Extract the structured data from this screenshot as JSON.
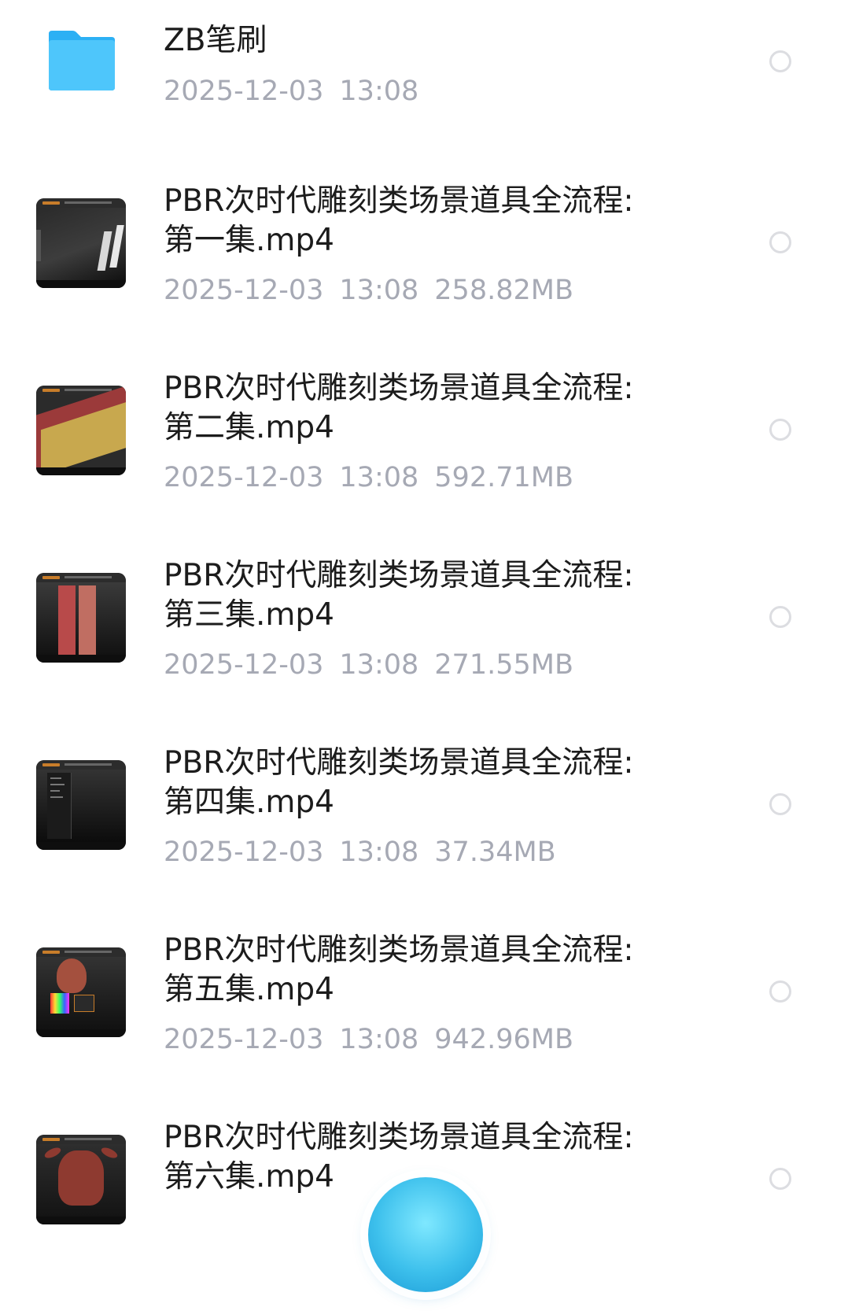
{
  "folder": {
    "name": "ZB笔刷",
    "date": "2025-12-03",
    "time": "13:08",
    "icon": "folder-icon",
    "color": "#2cb6f6"
  },
  "files": [
    {
      "name": "PBR次时代雕刻类场景道具全流程:\n第一集.mp4",
      "date": "2025-12-03",
      "time": "13:08",
      "size": "258.82MB"
    },
    {
      "name": "PBR次时代雕刻类场景道具全流程:\n第二集.mp4",
      "date": "2025-12-03",
      "time": "13:08",
      "size": "592.71MB"
    },
    {
      "name": "PBR次时代雕刻类场景道具全流程:\n第三集.mp4",
      "date": "2025-12-03",
      "time": "13:08",
      "size": "271.55MB"
    },
    {
      "name": "PBR次时代雕刻类场景道具全流程:\n第四集.mp4",
      "date": "2025-12-03",
      "time": "13:08",
      "size": "37.34MB"
    },
    {
      "name": "PBR次时代雕刻类场景道具全流程:\n第五集.mp4",
      "date": "2025-12-03",
      "time": "13:08",
      "size": "942.96MB"
    },
    {
      "name": "PBR次时代雕刻类场景道具全流程:\n第六集.mp4",
      "date": "",
      "time": "",
      "size": ""
    }
  ],
  "colors": {
    "title": "#1c1c1c",
    "meta": "#a6a9b4",
    "radio": "#dcdde1",
    "fab": "#3dc0ec"
  }
}
